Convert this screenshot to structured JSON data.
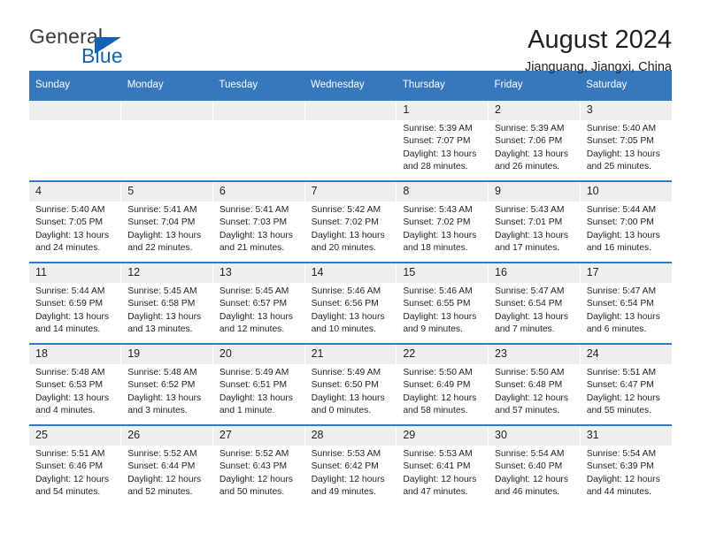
{
  "brand": {
    "name_top": "General",
    "name_bottom": "Blue",
    "triangle_color": "#1464b4"
  },
  "header": {
    "title": "August 2024",
    "subtitle": "Jianguang, Jiangxi, China"
  },
  "theme": {
    "header_blue": "#3777bc",
    "daynum_bg": "#efefef",
    "text": "#231f20"
  },
  "calendar": {
    "weekday_headers": [
      "Sunday",
      "Monday",
      "Tuesday",
      "Wednesday",
      "Thursday",
      "Friday",
      "Saturday"
    ],
    "labels": {
      "sunrise": "Sunrise:",
      "sunset": "Sunset:",
      "daylight": "Daylight:"
    },
    "weeks": [
      [
        {
          "day": "",
          "blank": true,
          "sunrise": "",
          "sunset": "",
          "daylight_1": "",
          "daylight_2": ""
        },
        {
          "day": "",
          "blank": true,
          "sunrise": "",
          "sunset": "",
          "daylight_1": "",
          "daylight_2": ""
        },
        {
          "day": "",
          "blank": true,
          "sunrise": "",
          "sunset": "",
          "daylight_1": "",
          "daylight_2": ""
        },
        {
          "day": "",
          "blank": true,
          "sunrise": "",
          "sunset": "",
          "daylight_1": "",
          "daylight_2": ""
        },
        {
          "day": "1",
          "blank": false,
          "sunrise": "Sunrise: 5:39 AM",
          "sunset": "Sunset: 7:07 PM",
          "daylight_1": "Daylight: 13 hours",
          "daylight_2": "and 28 minutes."
        },
        {
          "day": "2",
          "blank": false,
          "sunrise": "Sunrise: 5:39 AM",
          "sunset": "Sunset: 7:06 PM",
          "daylight_1": "Daylight: 13 hours",
          "daylight_2": "and 26 minutes."
        },
        {
          "day": "3",
          "blank": false,
          "sunrise": "Sunrise: 5:40 AM",
          "sunset": "Sunset: 7:05 PM",
          "daylight_1": "Daylight: 13 hours",
          "daylight_2": "and 25 minutes."
        }
      ],
      [
        {
          "day": "4",
          "blank": false,
          "sunrise": "Sunrise: 5:40 AM",
          "sunset": "Sunset: 7:05 PM",
          "daylight_1": "Daylight: 13 hours",
          "daylight_2": "and 24 minutes."
        },
        {
          "day": "5",
          "blank": false,
          "sunrise": "Sunrise: 5:41 AM",
          "sunset": "Sunset: 7:04 PM",
          "daylight_1": "Daylight: 13 hours",
          "daylight_2": "and 22 minutes."
        },
        {
          "day": "6",
          "blank": false,
          "sunrise": "Sunrise: 5:41 AM",
          "sunset": "Sunset: 7:03 PM",
          "daylight_1": "Daylight: 13 hours",
          "daylight_2": "and 21 minutes."
        },
        {
          "day": "7",
          "blank": false,
          "sunrise": "Sunrise: 5:42 AM",
          "sunset": "Sunset: 7:02 PM",
          "daylight_1": "Daylight: 13 hours",
          "daylight_2": "and 20 minutes."
        },
        {
          "day": "8",
          "blank": false,
          "sunrise": "Sunrise: 5:43 AM",
          "sunset": "Sunset: 7:02 PM",
          "daylight_1": "Daylight: 13 hours",
          "daylight_2": "and 18 minutes."
        },
        {
          "day": "9",
          "blank": false,
          "sunrise": "Sunrise: 5:43 AM",
          "sunset": "Sunset: 7:01 PM",
          "daylight_1": "Daylight: 13 hours",
          "daylight_2": "and 17 minutes."
        },
        {
          "day": "10",
          "blank": false,
          "sunrise": "Sunrise: 5:44 AM",
          "sunset": "Sunset: 7:00 PM",
          "daylight_1": "Daylight: 13 hours",
          "daylight_2": "and 16 minutes."
        }
      ],
      [
        {
          "day": "11",
          "blank": false,
          "sunrise": "Sunrise: 5:44 AM",
          "sunset": "Sunset: 6:59 PM",
          "daylight_1": "Daylight: 13 hours",
          "daylight_2": "and 14 minutes."
        },
        {
          "day": "12",
          "blank": false,
          "sunrise": "Sunrise: 5:45 AM",
          "sunset": "Sunset: 6:58 PM",
          "daylight_1": "Daylight: 13 hours",
          "daylight_2": "and 13 minutes."
        },
        {
          "day": "13",
          "blank": false,
          "sunrise": "Sunrise: 5:45 AM",
          "sunset": "Sunset: 6:57 PM",
          "daylight_1": "Daylight: 13 hours",
          "daylight_2": "and 12 minutes."
        },
        {
          "day": "14",
          "blank": false,
          "sunrise": "Sunrise: 5:46 AM",
          "sunset": "Sunset: 6:56 PM",
          "daylight_1": "Daylight: 13 hours",
          "daylight_2": "and 10 minutes."
        },
        {
          "day": "15",
          "blank": false,
          "sunrise": "Sunrise: 5:46 AM",
          "sunset": "Sunset: 6:55 PM",
          "daylight_1": "Daylight: 13 hours",
          "daylight_2": "and 9 minutes."
        },
        {
          "day": "16",
          "blank": false,
          "sunrise": "Sunrise: 5:47 AM",
          "sunset": "Sunset: 6:54 PM",
          "daylight_1": "Daylight: 13 hours",
          "daylight_2": "and 7 minutes."
        },
        {
          "day": "17",
          "blank": false,
          "sunrise": "Sunrise: 5:47 AM",
          "sunset": "Sunset: 6:54 PM",
          "daylight_1": "Daylight: 13 hours",
          "daylight_2": "and 6 minutes."
        }
      ],
      [
        {
          "day": "18",
          "blank": false,
          "sunrise": "Sunrise: 5:48 AM",
          "sunset": "Sunset: 6:53 PM",
          "daylight_1": "Daylight: 13 hours",
          "daylight_2": "and 4 minutes."
        },
        {
          "day": "19",
          "blank": false,
          "sunrise": "Sunrise: 5:48 AM",
          "sunset": "Sunset: 6:52 PM",
          "daylight_1": "Daylight: 13 hours",
          "daylight_2": "and 3 minutes."
        },
        {
          "day": "20",
          "blank": false,
          "sunrise": "Sunrise: 5:49 AM",
          "sunset": "Sunset: 6:51 PM",
          "daylight_1": "Daylight: 13 hours",
          "daylight_2": "and 1 minute."
        },
        {
          "day": "21",
          "blank": false,
          "sunrise": "Sunrise: 5:49 AM",
          "sunset": "Sunset: 6:50 PM",
          "daylight_1": "Daylight: 13 hours",
          "daylight_2": "and 0 minutes."
        },
        {
          "day": "22",
          "blank": false,
          "sunrise": "Sunrise: 5:50 AM",
          "sunset": "Sunset: 6:49 PM",
          "daylight_1": "Daylight: 12 hours",
          "daylight_2": "and 58 minutes."
        },
        {
          "day": "23",
          "blank": false,
          "sunrise": "Sunrise: 5:50 AM",
          "sunset": "Sunset: 6:48 PM",
          "daylight_1": "Daylight: 12 hours",
          "daylight_2": "and 57 minutes."
        },
        {
          "day": "24",
          "blank": false,
          "sunrise": "Sunrise: 5:51 AM",
          "sunset": "Sunset: 6:47 PM",
          "daylight_1": "Daylight: 12 hours",
          "daylight_2": "and 55 minutes."
        }
      ],
      [
        {
          "day": "25",
          "blank": false,
          "sunrise": "Sunrise: 5:51 AM",
          "sunset": "Sunset: 6:46 PM",
          "daylight_1": "Daylight: 12 hours",
          "daylight_2": "and 54 minutes."
        },
        {
          "day": "26",
          "blank": false,
          "sunrise": "Sunrise: 5:52 AM",
          "sunset": "Sunset: 6:44 PM",
          "daylight_1": "Daylight: 12 hours",
          "daylight_2": "and 52 minutes."
        },
        {
          "day": "27",
          "blank": false,
          "sunrise": "Sunrise: 5:52 AM",
          "sunset": "Sunset: 6:43 PM",
          "daylight_1": "Daylight: 12 hours",
          "daylight_2": "and 50 minutes."
        },
        {
          "day": "28",
          "blank": false,
          "sunrise": "Sunrise: 5:53 AM",
          "sunset": "Sunset: 6:42 PM",
          "daylight_1": "Daylight: 12 hours",
          "daylight_2": "and 49 minutes."
        },
        {
          "day": "29",
          "blank": false,
          "sunrise": "Sunrise: 5:53 AM",
          "sunset": "Sunset: 6:41 PM",
          "daylight_1": "Daylight: 12 hours",
          "daylight_2": "and 47 minutes."
        },
        {
          "day": "30",
          "blank": false,
          "sunrise": "Sunrise: 5:54 AM",
          "sunset": "Sunset: 6:40 PM",
          "daylight_1": "Daylight: 12 hours",
          "daylight_2": "and 46 minutes."
        },
        {
          "day": "31",
          "blank": false,
          "sunrise": "Sunrise: 5:54 AM",
          "sunset": "Sunset: 6:39 PM",
          "daylight_1": "Daylight: 12 hours",
          "daylight_2": "and 44 minutes."
        }
      ]
    ]
  }
}
